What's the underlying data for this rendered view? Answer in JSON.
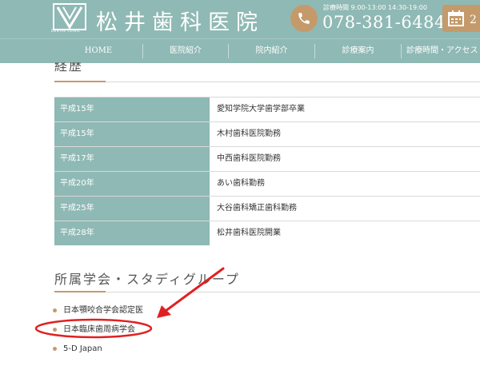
{
  "header": {
    "logo_caption": "DENTAL CLINIC",
    "clinic_name": "松井歯科医院",
    "hours": "診療時間  9:00-13:00 14:30-19:00",
    "phone": "078-381-6484",
    "calendar_text": "2・",
    "accent_color": "#c59a6b",
    "theme_color": "#8fb9b4"
  },
  "nav": {
    "items": [
      "HOME",
      "医院紹介",
      "院内紹介",
      "診療案内",
      "診療時間・アクセス"
    ]
  },
  "career": {
    "title": "経歴",
    "rows": [
      {
        "year": "平成15年",
        "desc": "愛知学院大学歯学部卒業"
      },
      {
        "year": "平成15年",
        "desc": "木村歯科医院勤務"
      },
      {
        "year": "平成17年",
        "desc": "中西歯科医院勤務"
      },
      {
        "year": "平成20年",
        "desc": "あい歯科勤務"
      },
      {
        "year": "平成25年",
        "desc": "大谷歯科矯正歯科勤務"
      },
      {
        "year": "平成28年",
        "desc": "松井歯科医院開業"
      }
    ]
  },
  "societies": {
    "title": "所属学会・スタディグループ",
    "items": [
      "日本顎咬合学会認定医",
      "日本臨床歯周病学会",
      "5-D Japan"
    ]
  },
  "annotation": {
    "color": "#e02020"
  }
}
